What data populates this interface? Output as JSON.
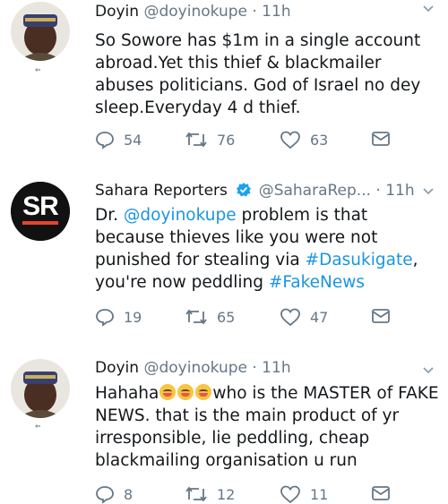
{
  "tweets": [
    {
      "name": "Doyin",
      "handle": "@doyinokupe",
      "time": "· 11h",
      "text": "So Sowore has $1m in a single account abroad.Yet this thief & blackmailer abuses politicians. God of Israel no dey sleep.Everyday 4 d thief.",
      "replies": "54",
      "retweets": "76",
      "likes": "63"
    },
    {
      "name": "Sahara Reporters",
      "handle": "@SaharaRep...",
      "time": "· 11h",
      "avatar_text": "SR",
      "text_parts": {
        "p1": "Dr. ",
        "mention": "@doyinokupe",
        "p2": " problem is that because thieves like you were not punished for stealing via ",
        "hashtag1": "#Dasukigate",
        "p3": ", you're now peddling ",
        "hashtag2": "#FakeNews"
      },
      "replies": "19",
      "retweets": "65",
      "likes": "47"
    },
    {
      "name": "Doyin",
      "handle": "@doyinokupe",
      "time": "· 11h",
      "text_parts": {
        "p1": "Hahaha",
        "p2": "who is the MASTER of FAKE NEWS. that is the main product of yr irresponsible,  lie peddling, cheap blackmailing organisation u run"
      },
      "replies": "8",
      "retweets": "12",
      "likes": "11"
    }
  ],
  "colors": {
    "text": "#14171a",
    "muted": "#657786",
    "link": "#1b95e0",
    "verified": "#1da1f2",
    "sr_red": "#e8442e"
  }
}
